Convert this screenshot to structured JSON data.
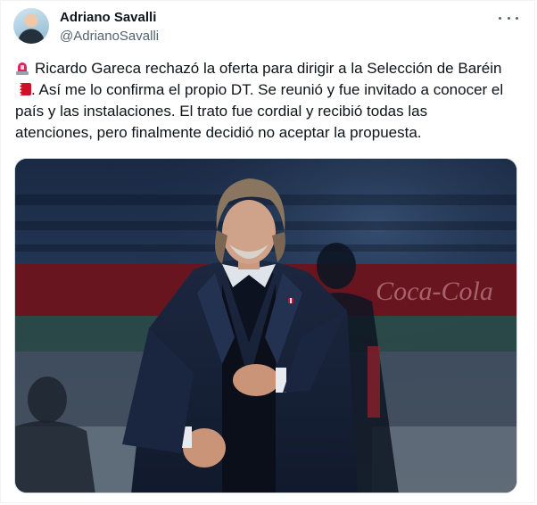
{
  "tweet": {
    "author": {
      "display_name": "Adriano Savalli",
      "handle": "@AdrianoSavalli"
    },
    "more_icon": "more-horizontal-icon",
    "text_lines": [
      "Ricardo Gareca rechazó la oferta para dirigir a la Selección de Baréin",
      ". Así me lo confirma el propio DT. Se reunió y fue invitado a conocer el",
      "país y las instalaciones. El trato fue cordial y recibió todas las",
      "atenciones, pero finalmente decidió no aceptar la propuesta."
    ],
    "emojis": [
      "rotating-light-icon",
      "bahrain-flag-icon"
    ],
    "media": {
      "subject": "photo-coach-in-stadium",
      "background_text": "Coca-Cola"
    }
  },
  "colors": {
    "text": "#0f1419",
    "secondary": "#536471",
    "border": "#cfd9de"
  }
}
